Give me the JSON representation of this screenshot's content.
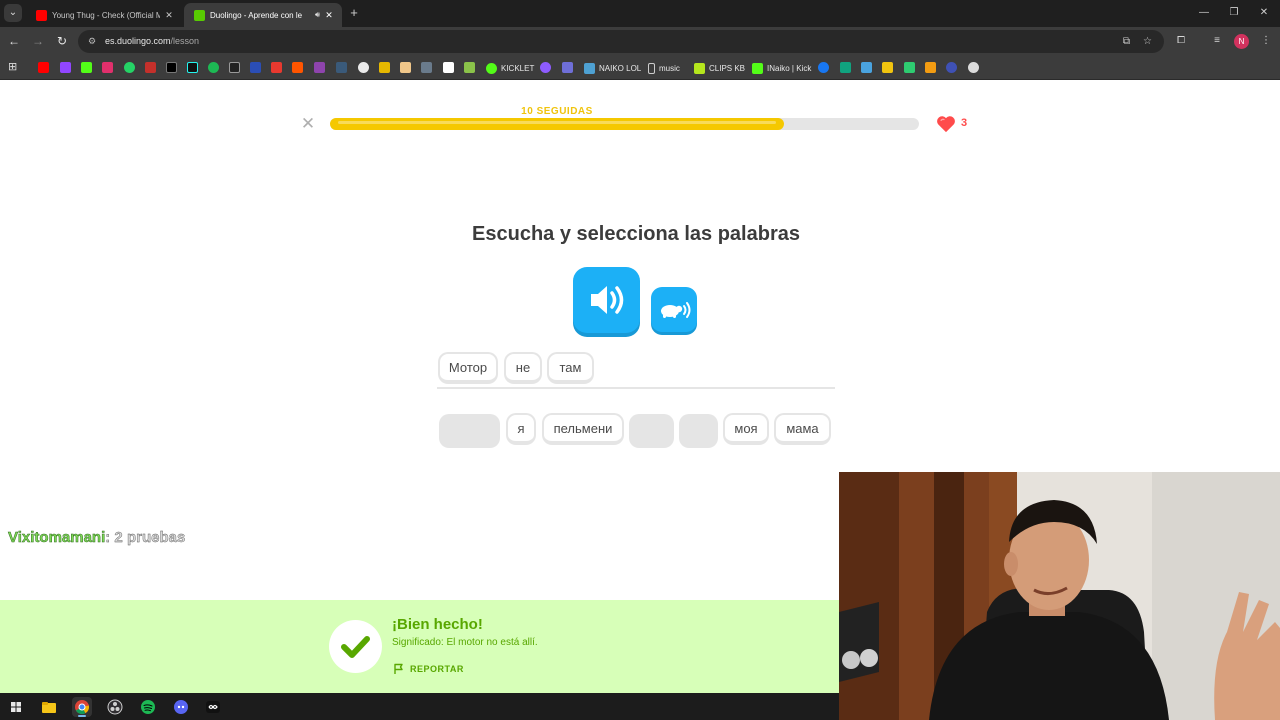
{
  "browser": {
    "tabs": [
      {
        "label": "Young Thug - Check (Official M",
        "favicon_color": "#ff0000",
        "active": false
      },
      {
        "label": "Duolingo - Aprende con le",
        "favicon_color": "#58cc02",
        "active": true
      }
    ],
    "url_host": "es.duolingo.com",
    "url_path": "/lesson",
    "profile_initial": "N",
    "bookmarks_labeled": [
      "KICKLET",
      "NAIKO LOL",
      "music",
      "CLIPS KB",
      "INaiko | Kick"
    ]
  },
  "lesson": {
    "streak_label": "10 SEGUIDAS",
    "progress": 0.77,
    "hearts": "3",
    "instruction": "Escucha y selecciona las palabras",
    "selected_words": [
      "Мотор",
      "не",
      "там"
    ],
    "word_bank": [
      {
        "text": "",
        "used": true
      },
      {
        "text": "я",
        "used": false
      },
      {
        "text": "пельмени",
        "used": false
      },
      {
        "text": "",
        "used": true
      },
      {
        "text": "",
        "used": true
      },
      {
        "text": "моя",
        "used": false
      },
      {
        "text": "мама",
        "used": false
      }
    ]
  },
  "feedback": {
    "title": "¡Bien hecho!",
    "meaning": "Significado: El motor no está allí.",
    "report_label": "REPORTAR"
  },
  "chat": {
    "user": "Vixitomamani",
    "message": ": 2 pruebas"
  },
  "colors": {
    "duo_blue": "#1cb0f6",
    "duo_green": "#58a700",
    "feedback_bg": "#d7ffb8",
    "streak_yellow": "#f5c800",
    "heart_red": "#ff4b4b"
  }
}
